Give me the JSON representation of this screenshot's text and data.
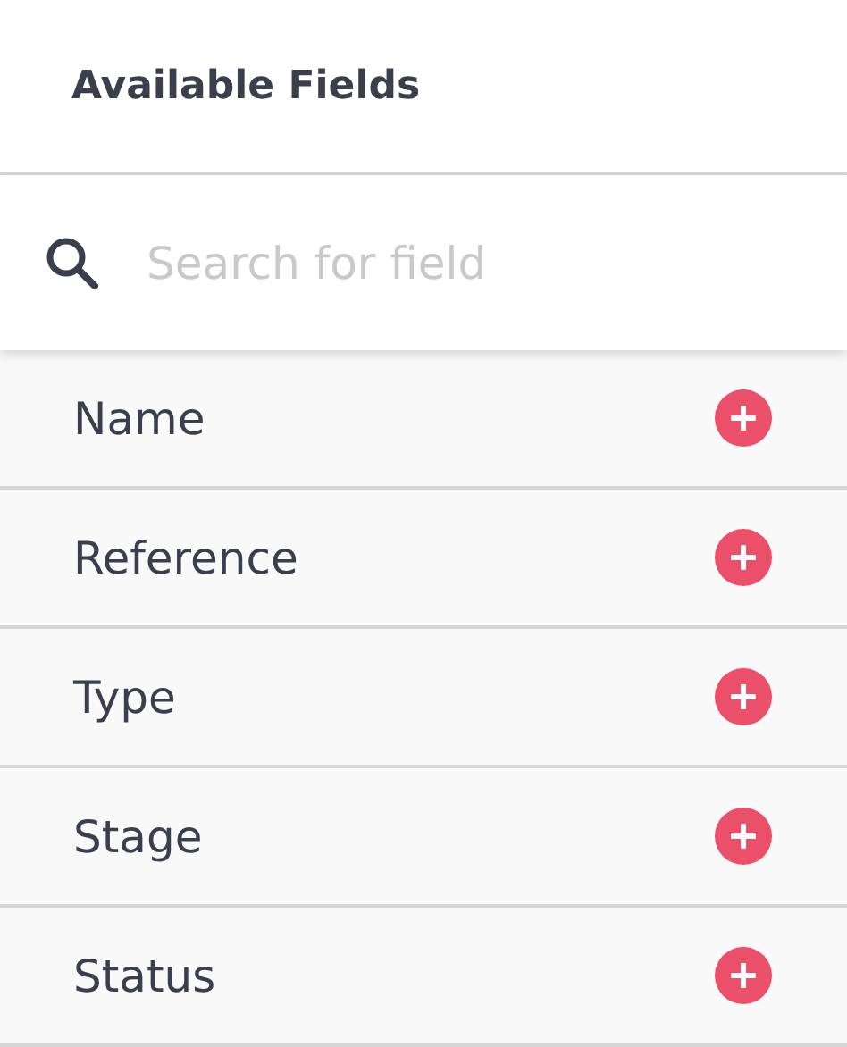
{
  "panel": {
    "title": "Available Fields"
  },
  "search": {
    "placeholder": "Search for field"
  },
  "fields": [
    {
      "label": "Name"
    },
    {
      "label": "Reference"
    },
    {
      "label": "Type"
    },
    {
      "label": "Stage"
    },
    {
      "label": "Status"
    }
  ]
}
